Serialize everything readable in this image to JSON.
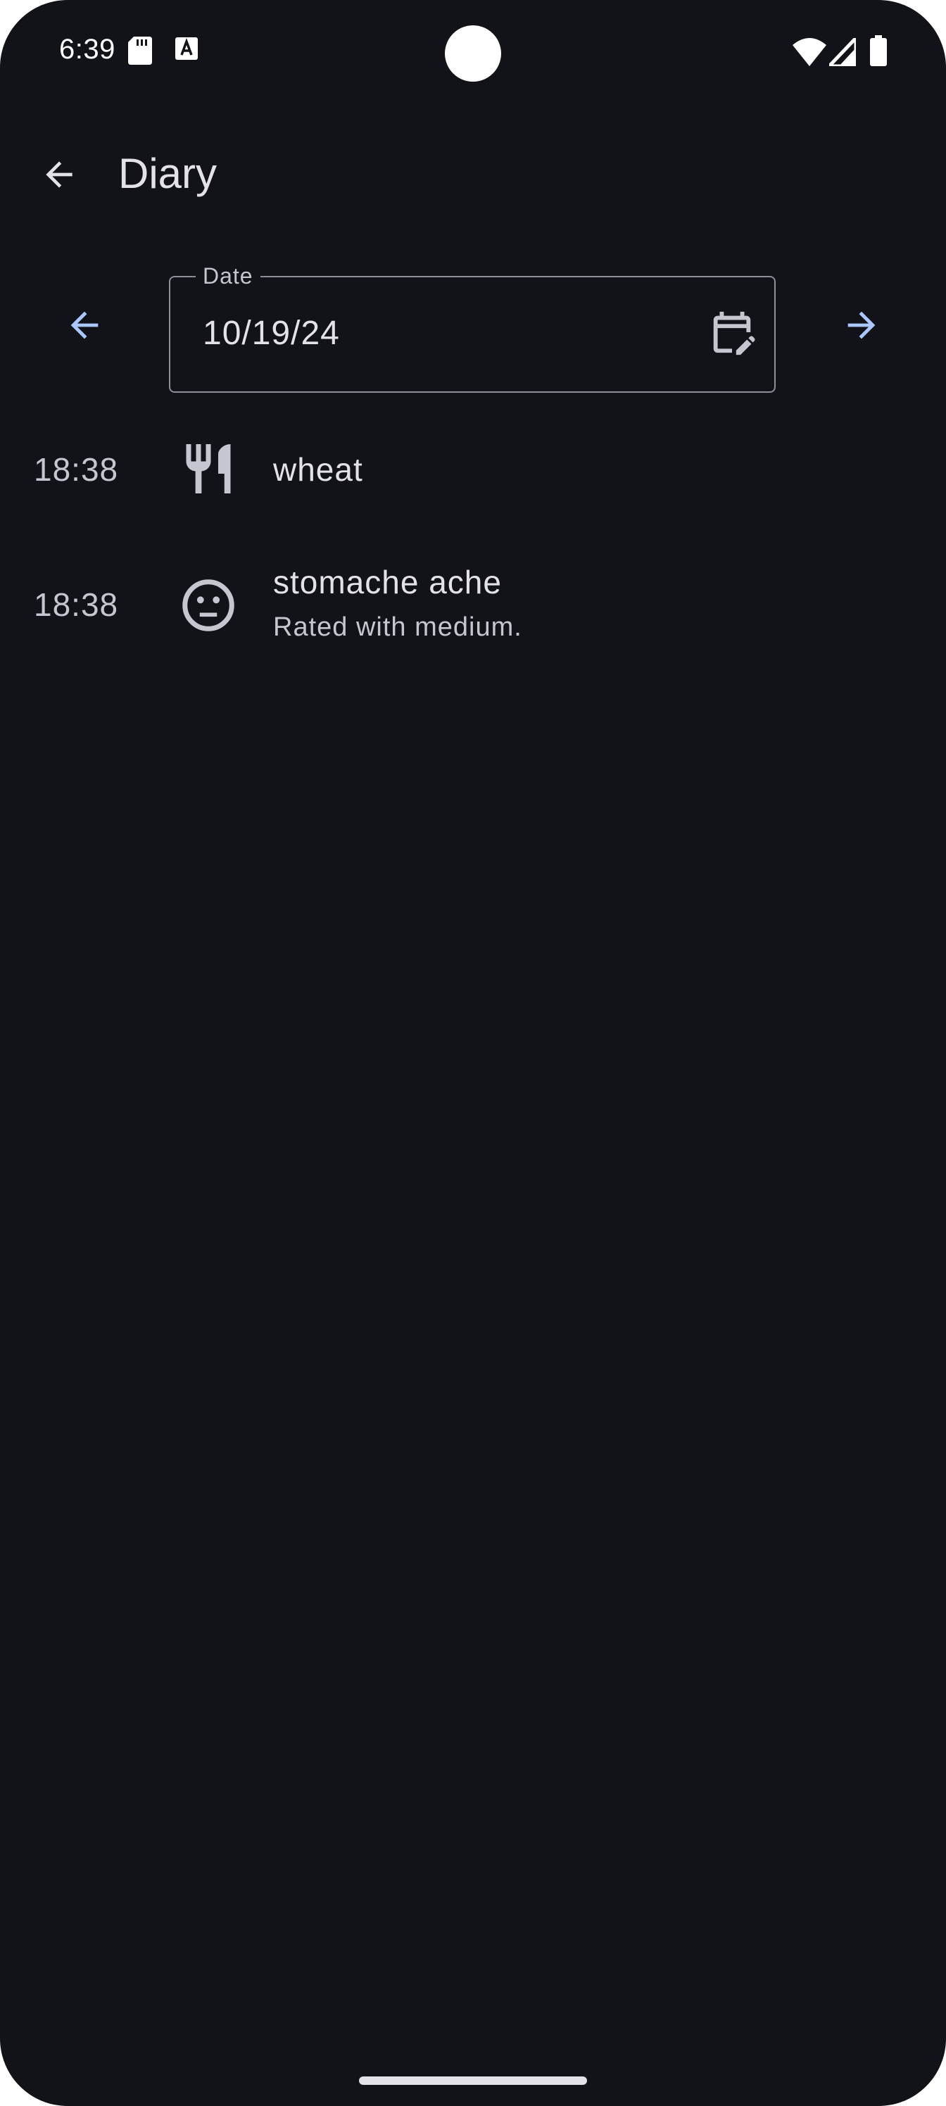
{
  "status_bar": {
    "time": "6:39"
  },
  "app_bar": {
    "title": "Diary"
  },
  "date_picker": {
    "label": "Date",
    "value": "10/19/24"
  },
  "entries": [
    {
      "time": "18:38",
      "icon": "restaurant-icon",
      "title": "wheat",
      "subtitle": ""
    },
    {
      "time": "18:38",
      "icon": "neutral-face-icon",
      "title": "stomache ache",
      "subtitle": "Rated with medium."
    }
  ],
  "colors": {
    "background": "#121318",
    "on_surface": "#e3e2e9",
    "on_surface_variant": "#c5c6d0",
    "outline": "#8e9099",
    "accent": "#aac7ff"
  }
}
